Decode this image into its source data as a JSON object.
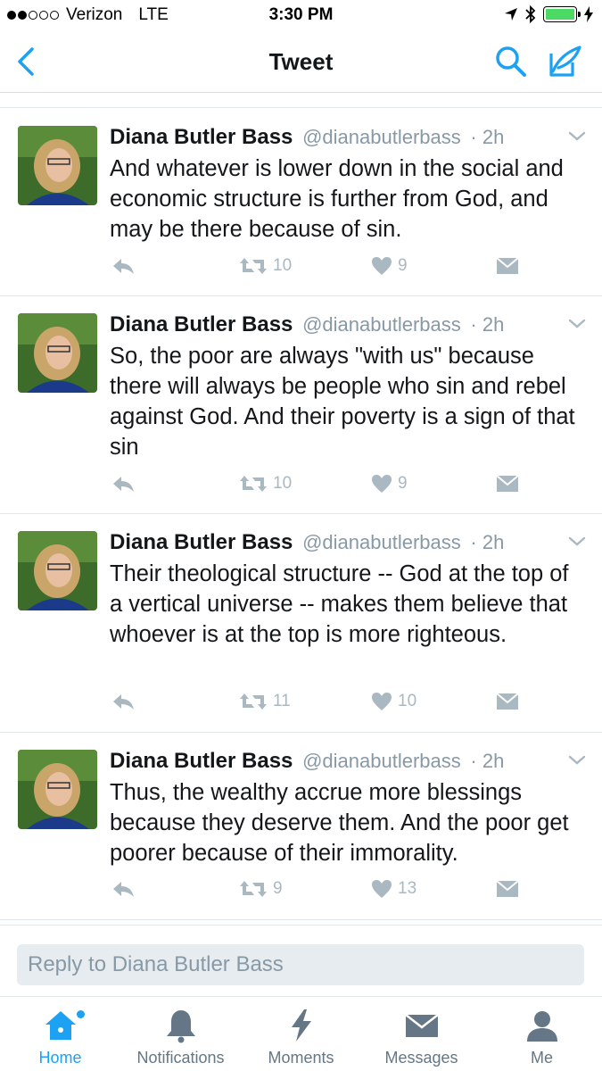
{
  "status_bar": {
    "carrier": "Verizon",
    "network": "LTE",
    "time": "3:30 PM",
    "battery_color": "#4cd964"
  },
  "nav": {
    "title": "Tweet",
    "back_icon": "chevron-left-icon",
    "search_icon": "search-icon",
    "compose_icon": "compose-icon",
    "accent": "#1da1f2"
  },
  "tweets": [
    {
      "name": "Diana Butler Bass",
      "handle": "@dianabutlerbass",
      "time": "· 2h",
      "text": "And whatever is lower down in the social and economic structure is further from God, and may be there because of sin.",
      "retweets": "10",
      "likes": "9"
    },
    {
      "name": "Diana Butler Bass",
      "handle": "@dianabutlerbass",
      "time": "· 2h",
      "text": "So, the poor are always \"with us\" because there will always be people who sin and rebel against God. And their poverty is a sign of that sin",
      "retweets": "10",
      "likes": "9"
    },
    {
      "name": "Diana Butler Bass",
      "handle": "@dianabutlerbass",
      "time": "· 2h",
      "text": "Their theological structure -- God at the top of a vertical universe -- makes them believe that whoever is at the top is more righteous.",
      "retweets": "11",
      "likes": "10"
    },
    {
      "name": "Diana Butler Bass",
      "handle": "@dianabutlerbass",
      "time": "· 2h",
      "text": "Thus, the wealthy accrue more blessings because they deserve them. And the poor get poorer because of their immorality.",
      "retweets": "9",
      "likes": "13"
    }
  ],
  "reply": {
    "placeholder": "Reply to Diana Butler Bass"
  },
  "tabs": [
    {
      "label": "Home",
      "icon": "home-icon"
    },
    {
      "label": "Notifications",
      "icon": "bell-icon"
    },
    {
      "label": "Moments",
      "icon": "lightning-icon"
    },
    {
      "label": "Messages",
      "icon": "envelope-icon"
    },
    {
      "label": "Me",
      "icon": "person-icon"
    }
  ]
}
